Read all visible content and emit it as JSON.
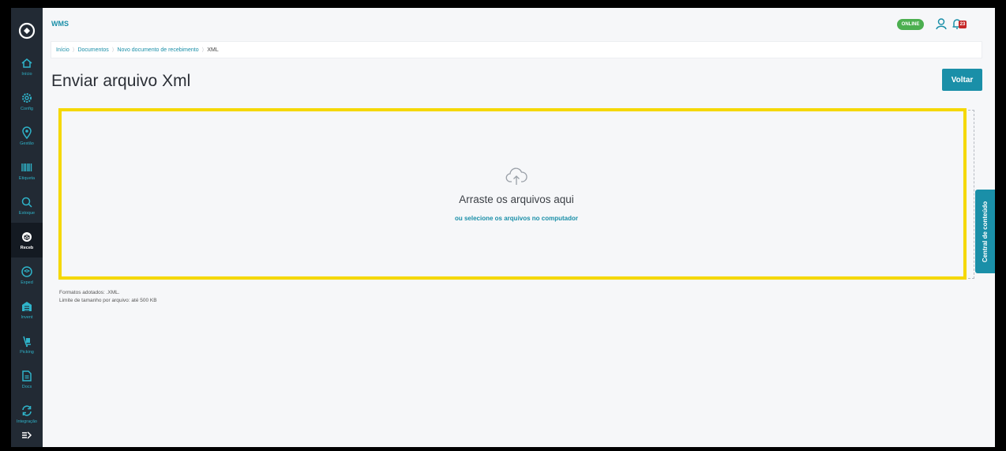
{
  "app": {
    "name": "WMS",
    "status": "ONLINE",
    "notifications": "23"
  },
  "sidebar": {
    "items": [
      {
        "label": "Início",
        "icon": "home-icon"
      },
      {
        "label": "Config",
        "icon": "gear-icon"
      },
      {
        "label": "Gestão",
        "icon": "location-pin-icon"
      },
      {
        "label": "Etiqueta",
        "icon": "barcode-icon"
      },
      {
        "label": "Estoque",
        "icon": "search-icon"
      },
      {
        "label": "Receb",
        "icon": "box-icon",
        "active": true
      },
      {
        "label": "Exped",
        "icon": "box-outline-icon"
      },
      {
        "label": "Invent",
        "icon": "warehouse-icon"
      },
      {
        "label": "Picking",
        "icon": "hand-cart-icon"
      },
      {
        "label": "Docs",
        "icon": "document-icon"
      },
      {
        "label": "Integração",
        "icon": "sync-icon"
      }
    ]
  },
  "breadcrumb": [
    "Início",
    "Documentos",
    "Novo documento de recebimento",
    "XML"
  ],
  "page": {
    "title": "Enviar arquivo Xml",
    "back_label": "Voltar"
  },
  "dropzone": {
    "title": "Arraste os arquivos aqui",
    "link": "ou selecione os arquivos no computador"
  },
  "info": {
    "formats": "Formatos adotados: .XML.",
    "limit": "Limite de tamanho por arquivo: até 500 KB"
  },
  "side_tab": "Central de conteúdo",
  "colors": {
    "accent": "#1a8fa8",
    "sidebar": "#222a34",
    "highlight": "#f5d800",
    "online": "#4caf50"
  }
}
